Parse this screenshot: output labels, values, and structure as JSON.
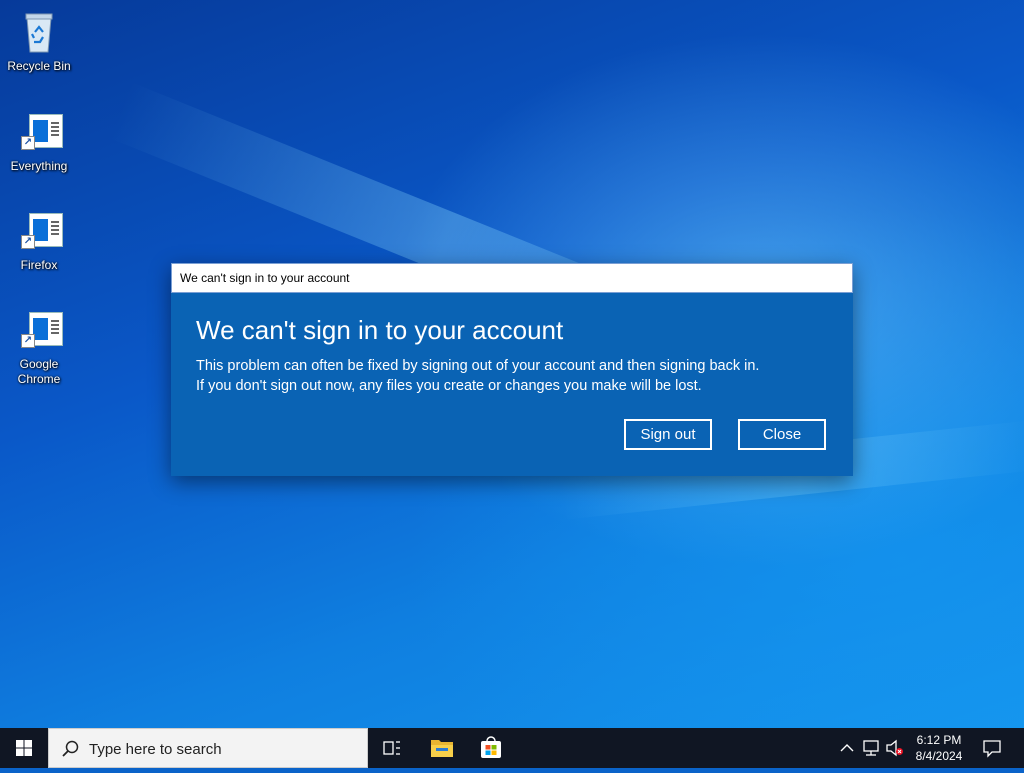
{
  "desktop": {
    "icons": [
      {
        "label": "Recycle Bin",
        "icon": "recycle-bin-icon"
      },
      {
        "label": "Everything",
        "icon": "app-shortcut-icon"
      },
      {
        "label": "Firefox",
        "icon": "app-shortcut-icon"
      },
      {
        "label": "Google Chrome",
        "icon": "app-shortcut-icon"
      }
    ]
  },
  "dialog": {
    "title": "We can't sign in to your account",
    "heading": "We can't sign in to your account",
    "message_line1": "This problem can often be fixed by signing out of your account and then signing back in.",
    "message_line2": "If you don't sign out now, any files you create or changes you make will be lost.",
    "sign_out_label": "Sign out",
    "close_label": "Close"
  },
  "taskbar": {
    "search_placeholder": "Type here to search",
    "time": "6:12 PM",
    "date": "8/4/2024",
    "pinned": [
      "task-view-icon",
      "file-explorer-icon",
      "store-icon"
    ],
    "tray": [
      "chevron-up-icon",
      "network-icon",
      "volume-muted-icon",
      "notification-icon"
    ]
  },
  "colors": {
    "dialog_body": "#0a63b4",
    "taskbar": "#101623",
    "search_box": "#f3f3f3"
  }
}
